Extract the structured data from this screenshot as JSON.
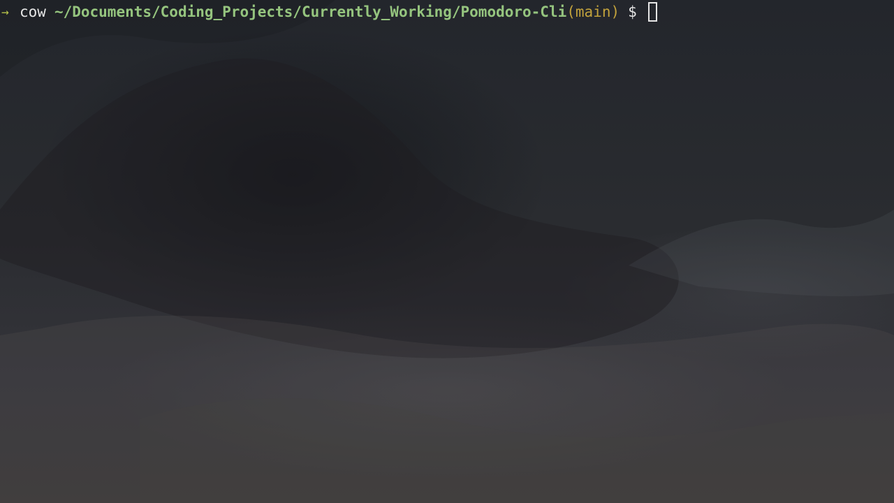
{
  "terminal": {
    "prompt": {
      "arrow": "→",
      "user": "cow",
      "cwd": "~/Documents/Coding_Projects/Currently_Working/Pomodoro-Cli",
      "branch": "(main)",
      "symbol": "$"
    },
    "colors": {
      "arrow": "#b6c24a",
      "user": "#e6e6e6",
      "cwd": "#95c47e",
      "branch": "#c2a23c",
      "text": "#e6e6e6"
    },
    "background_image": "dark-landscape-wallpaper"
  }
}
